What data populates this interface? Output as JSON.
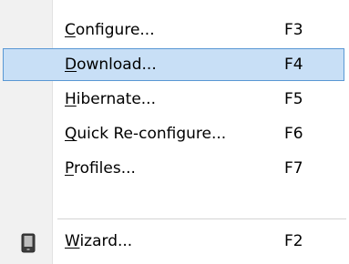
{
  "menu": {
    "items": [
      {
        "mnemonic": "C",
        "rest": "onfigure...",
        "shortcut": "F3"
      },
      {
        "mnemonic": "D",
        "rest": "ownload...",
        "shortcut": "F4"
      },
      {
        "mnemonic": "H",
        "rest": "ibernate...",
        "shortcut": "F5"
      },
      {
        "mnemonic": "Q",
        "rest": "uick Re-configure...",
        "shortcut": "F6"
      },
      {
        "mnemonic": "P",
        "rest": "rofiles...",
        "shortcut": "F7"
      },
      {
        "mnemonic": "W",
        "rest": "izard...",
        "shortcut": "F2",
        "icon": "wizard-icon"
      }
    ],
    "highlighted_index": 1,
    "colors": {
      "highlight_fill": "#c8dff6",
      "highlight_border": "#5a98d4",
      "gutter": "#f1f1f1",
      "separator": "#d4d4d4"
    }
  }
}
